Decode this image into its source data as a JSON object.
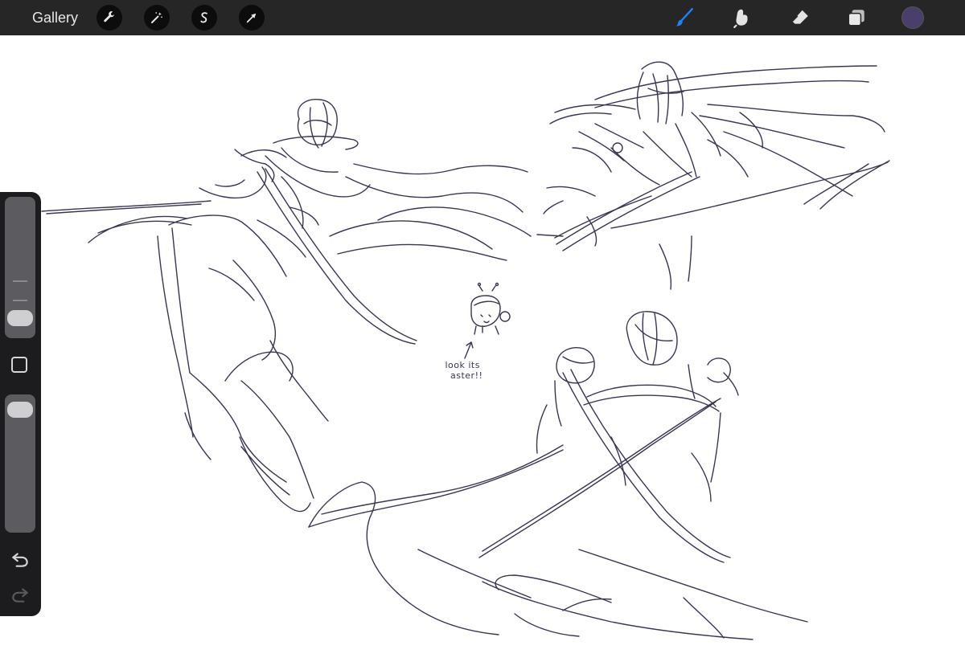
{
  "toolbar": {
    "gallery_label": "Gallery",
    "left_tools": [
      {
        "icon": "wrench-icon",
        "name": "actions"
      },
      {
        "icon": "magic-wand-icon",
        "name": "adjustments"
      },
      {
        "icon": "selection-s-icon",
        "name": "selection"
      },
      {
        "icon": "arrow-cursor-icon",
        "name": "transform"
      }
    ],
    "right_tools": [
      {
        "icon": "brush-icon",
        "name": "paint",
        "active": true
      },
      {
        "icon": "smudge-icon",
        "name": "smudge",
        "active": false
      },
      {
        "icon": "eraser-icon",
        "name": "erase",
        "active": false
      },
      {
        "icon": "layers-icon",
        "name": "layers",
        "active": false
      }
    ],
    "current_color": "#4a3f6b",
    "active_tool_color": "#1a84ff"
  },
  "sidebar": {
    "brush_size_level": 0.08,
    "brush_opacity_level": 0.96,
    "undo_icon": "undo-arrow-icon",
    "redo_icon": "redo-arrow-icon"
  },
  "canvas": {
    "ink_color": "#3a3550",
    "note_line1": "look its",
    "note_line2": "aster!!"
  }
}
